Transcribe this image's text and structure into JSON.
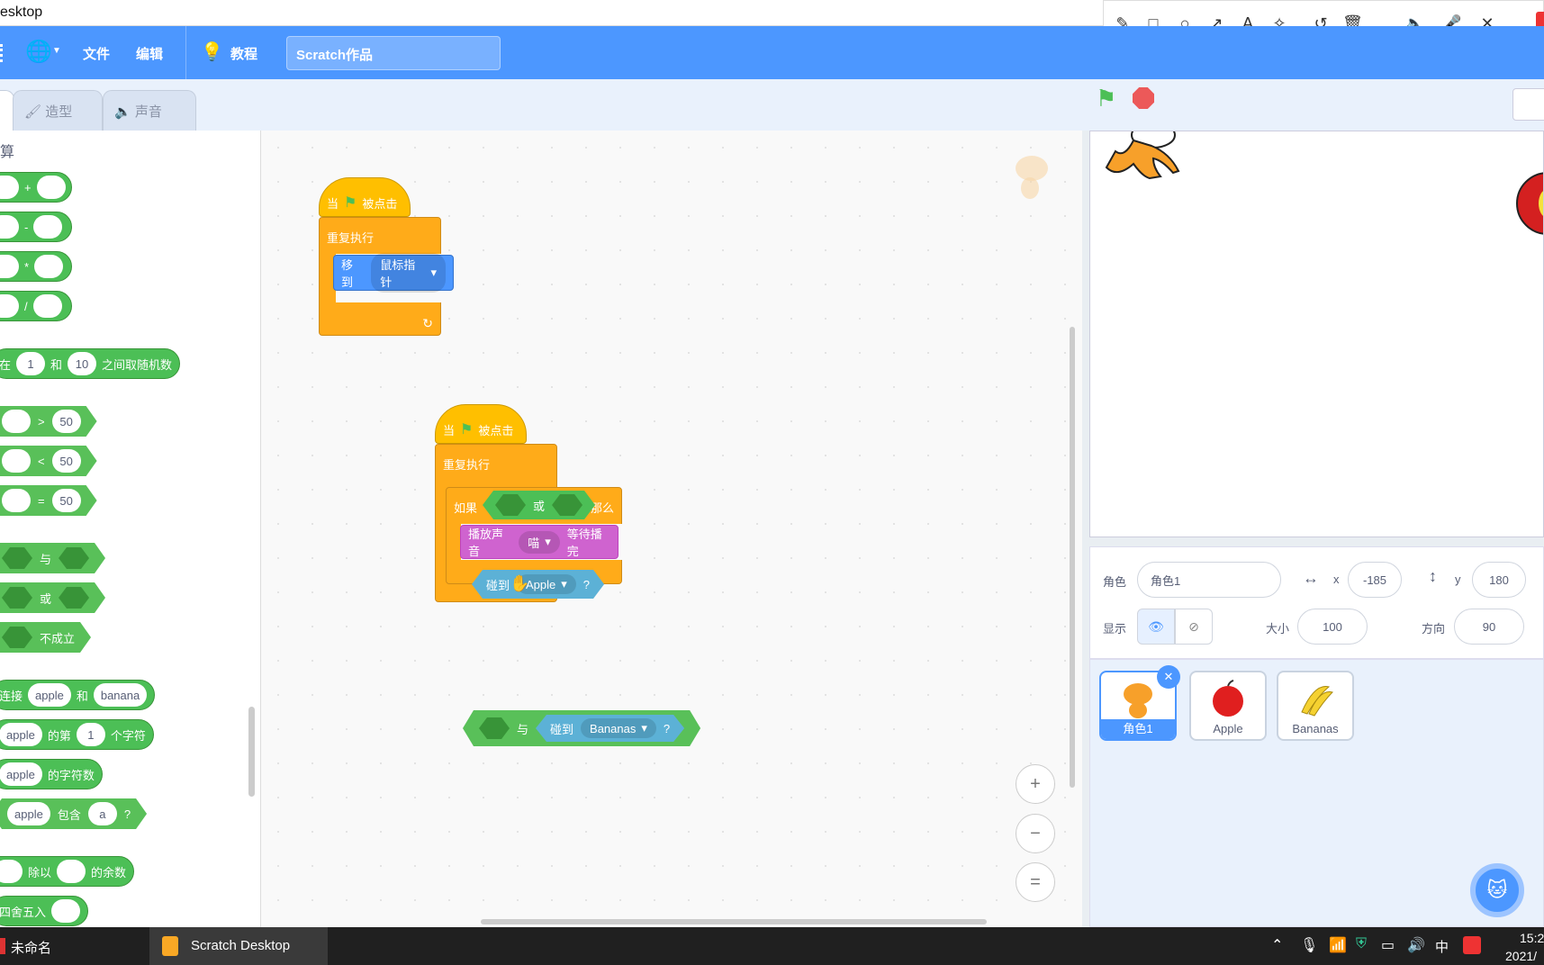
{
  "titlebar": {
    "title": "esktop"
  },
  "menubar": {
    "file": "文件",
    "edit": "编辑",
    "tutorials": "教程",
    "project_title": "Scratch作品"
  },
  "tabs": {
    "costumes": "造型",
    "sounds": "声音"
  },
  "palette": {
    "category": "算",
    "add_op": "+",
    "sub_op": "-",
    "mul_op": "*",
    "div_op": "/",
    "random": {
      "pre": "在",
      "a": "1",
      "mid": "和",
      "b": "10",
      "post": "之间取随机数"
    },
    "gt": {
      "op": ">",
      "v": "50"
    },
    "lt": {
      "op": "<",
      "v": "50"
    },
    "eq": {
      "op": "=",
      "v": "50"
    },
    "and": "与",
    "or": "或",
    "not": "不成立",
    "join": {
      "pre": "连接",
      "a": "apple",
      "mid": "和",
      "b": "banana"
    },
    "letter": {
      "a": "apple",
      "mid": "的第",
      "n": "1",
      "post": "个字符"
    },
    "length": {
      "a": "apple",
      "post": "的字符数"
    },
    "contains": {
      "a": "apple",
      "mid": "包含",
      "b": "a",
      "q": "?"
    },
    "mod": {
      "mid": "除以",
      "post": "的余数"
    },
    "round": {
      "pre": "四舍五入"
    }
  },
  "script1": {
    "when": "当",
    "clicked": "被点击",
    "forever": "重复执行",
    "goto": "移到",
    "target": "鼠标指针"
  },
  "script2": {
    "when": "当",
    "clicked": "被点击",
    "forever": "重复执行",
    "if": "如果",
    "or": "或",
    "then": "那么",
    "play": "播放声音",
    "sound": "喵",
    "until_done": "等待播完",
    "touching": "碰到",
    "apple": "Apple",
    "q": "?"
  },
  "script3": {
    "and": "与",
    "touching": "碰到",
    "bananas": "Bananas",
    "q": "?"
  },
  "zoom": {
    "in": "+",
    "out": "−",
    "reset": "="
  },
  "sprite_info": {
    "sprite_label": "角色",
    "sprite_name": "角色1",
    "x_label": "x",
    "x_value": "-185",
    "y_label": "y",
    "y_value": "180",
    "show_label": "显示",
    "size_label": "大小",
    "size_value": "100",
    "direction_label": "方向",
    "direction_value": "90"
  },
  "sprites": [
    {
      "name": "角色1"
    },
    {
      "name": "Apple"
    },
    {
      "name": "Bananas"
    }
  ],
  "taskbar": {
    "app1": "未命名",
    "app2": "Scratch Desktop",
    "ime": "中",
    "time": "15:2",
    "date": "2021/"
  },
  "colors": {
    "menubar": "#4c97ff",
    "operators": "#59c059",
    "events": "#ffbf00",
    "control": "#ffab19",
    "motion": "#4c97ff",
    "sound": "#cf63cf",
    "sensing": "#5cb1d6"
  }
}
